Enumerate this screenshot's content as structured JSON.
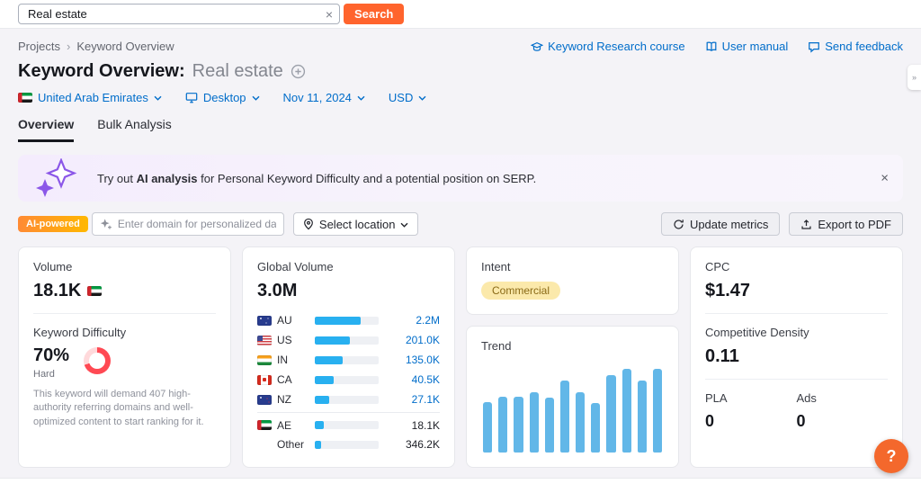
{
  "search": {
    "value": "Real estate",
    "clear_icon": "×",
    "button_label": "Search"
  },
  "breadcrumb": {
    "items": [
      "Projects",
      "Keyword Overview"
    ],
    "separator": "›"
  },
  "header_links": {
    "course": "Keyword Research course",
    "manual": "User manual",
    "feedback": "Send feedback"
  },
  "page_header": {
    "title": "Keyword Overview:",
    "keyword": "Real estate"
  },
  "filters": {
    "database": "United Arab Emirates",
    "device": "Desktop",
    "date": "Nov 11, 2024",
    "currency": "USD"
  },
  "tabs": {
    "overview": "Overview",
    "bulk": "Bulk Analysis"
  },
  "banner": {
    "prefix": "Try out ",
    "bold": "AI analysis",
    "suffix": " for Personal Keyword Difficulty and a potential position on SERP.",
    "close_icon": "×"
  },
  "toolbar": {
    "ai_badge": "AI-powered",
    "domain_placeholder": "Enter domain for personalized data",
    "location_label": "Select location",
    "update_label": "Update metrics",
    "export_label": "Export to PDF"
  },
  "cards": {
    "volume": {
      "title": "Volume",
      "value": "18.1K"
    },
    "difficulty": {
      "title": "Keyword Difficulty",
      "value": "70%",
      "percent": 70,
      "level": "Hard",
      "description": "This keyword will demand 407 high-authority referring domains and well-optimized content to start ranking for it."
    },
    "global_volume": {
      "title": "Global Volume",
      "value": "3.0M",
      "rows": [
        {
          "country": "AU",
          "flag": "au",
          "value": "2.2M",
          "bar_percent": 72,
          "dark_value": false,
          "divider_above": false
        },
        {
          "country": "US",
          "flag": "us",
          "value": "201.0K",
          "bar_percent": 55,
          "dark_value": false,
          "divider_above": false
        },
        {
          "country": "IN",
          "flag": "in",
          "value": "135.0K",
          "bar_percent": 44,
          "dark_value": false,
          "divider_above": false
        },
        {
          "country": "CA",
          "flag": "ca",
          "value": "40.5K",
          "bar_percent": 30,
          "dark_value": false,
          "divider_above": false
        },
        {
          "country": "NZ",
          "flag": "nz",
          "value": "27.1K",
          "bar_percent": 22,
          "dark_value": false,
          "divider_above": false
        },
        {
          "country": "AE",
          "flag": "ae",
          "value": "18.1K",
          "bar_percent": 14,
          "dark_value": true,
          "divider_above": true
        },
        {
          "country": "Other",
          "flag": null,
          "value": "346.2K",
          "bar_percent": 10,
          "dark_value": true,
          "divider_above": false
        }
      ]
    },
    "intent": {
      "title": "Intent",
      "badge": "Commercial"
    },
    "trend": {
      "title": "Trend"
    },
    "cpc": {
      "title": "CPC",
      "value": "$1.47"
    },
    "competitive_density": {
      "title": "Competitive Density",
      "value": "0.11"
    },
    "pla": {
      "title": "PLA",
      "value": "0"
    },
    "ads": {
      "title": "Ads",
      "value": "0"
    }
  },
  "chart_data": [
    {
      "type": "bar",
      "title": "Trend",
      "xlabel": "",
      "ylabel": "",
      "x": [
        1,
        2,
        3,
        4,
        5,
        6,
        7,
        8,
        9,
        10,
        11,
        12
      ],
      "values": [
        57,
        63,
        63,
        68,
        62,
        81,
        68,
        56,
        87,
        94,
        81,
        94
      ],
      "ylim": [
        0,
        100
      ],
      "note": "relative monthly interest, axis labels not shown in UI"
    },
    {
      "type": "bar",
      "title": "Global Volume by country",
      "categories": [
        "AU",
        "US",
        "IN",
        "CA",
        "NZ",
        "AE",
        "Other"
      ],
      "values_text": [
        "2.2M",
        "201.0K",
        "135.0K",
        "40.5K",
        "27.1K",
        "18.1K",
        "346.2K"
      ],
      "bar_percent": [
        72,
        55,
        44,
        30,
        22,
        14,
        10
      ],
      "total": "3.0M"
    }
  ],
  "icons": {
    "clear": "×",
    "breadcrumb_sep": "›",
    "close": "×",
    "help": "?",
    "side_tab": "»",
    "course": "graduation-cap",
    "manual": "book",
    "feedback": "speech-bubble",
    "device": "monitor",
    "location": "map-pin",
    "update": "refresh-arrow",
    "export": "upload-arrow",
    "ai_sparkle": "sparkle-plus",
    "add_keyword": "plus-circle"
  },
  "misc": {
    "help_button": "?",
    "side_tab_glyph": "»",
    "kd_ring_color": "#ff4953",
    "kd_ring_rest": "#ffd9db",
    "accent_orange": "#ff642d",
    "link_blue": "#006dca",
    "bar_blue": "#28b0f0",
    "trend_bar_blue": "#62b7e8"
  }
}
